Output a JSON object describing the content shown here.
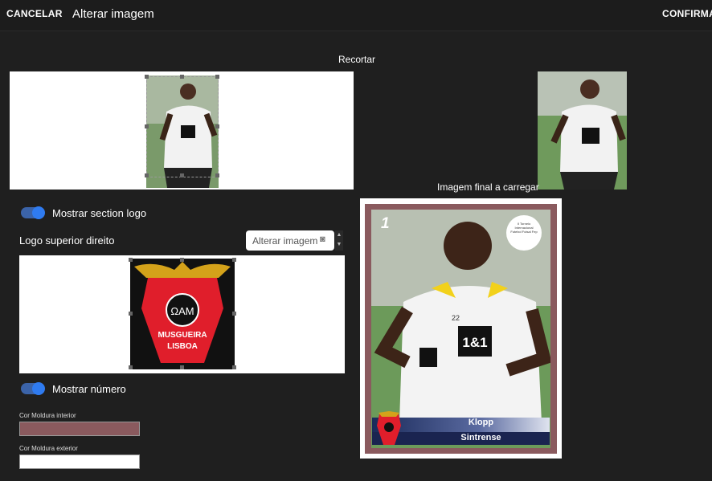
{
  "topbar": {
    "cancel_label": "CANCELAR",
    "title": "Alterar imagem",
    "confirm_label": "CONFIRMA"
  },
  "crop": {
    "heading": "Recortar"
  },
  "preview": {
    "heading": "Imagem final a carregar"
  },
  "section_logo": {
    "toggle_label": "Mostrar section logo",
    "enabled": true
  },
  "logo_top_right": {
    "label": "Logo superior direito",
    "button_label": "Alterar imagem"
  },
  "club_badge": {
    "initials": "ΩAM",
    "line1": "MUSGUEIRA",
    "line2": "LISBOA"
  },
  "show_number": {
    "toggle_label": "Mostrar número",
    "enabled": true
  },
  "colors": {
    "inner_label": "Cor Moldura interior",
    "inner_value": "#8a5a5e",
    "outer_label": "Cor Moldura exterior",
    "outer_value": "#ffffff",
    "accent": "#2f7bf0"
  },
  "card": {
    "number": "1",
    "sponsor": "1&1",
    "shirt_number": "22",
    "player_name": "Klopp",
    "team_name": "Sintrense",
    "round_logo_text": "II Torneio Internacional Futebol Futsal Fep"
  }
}
